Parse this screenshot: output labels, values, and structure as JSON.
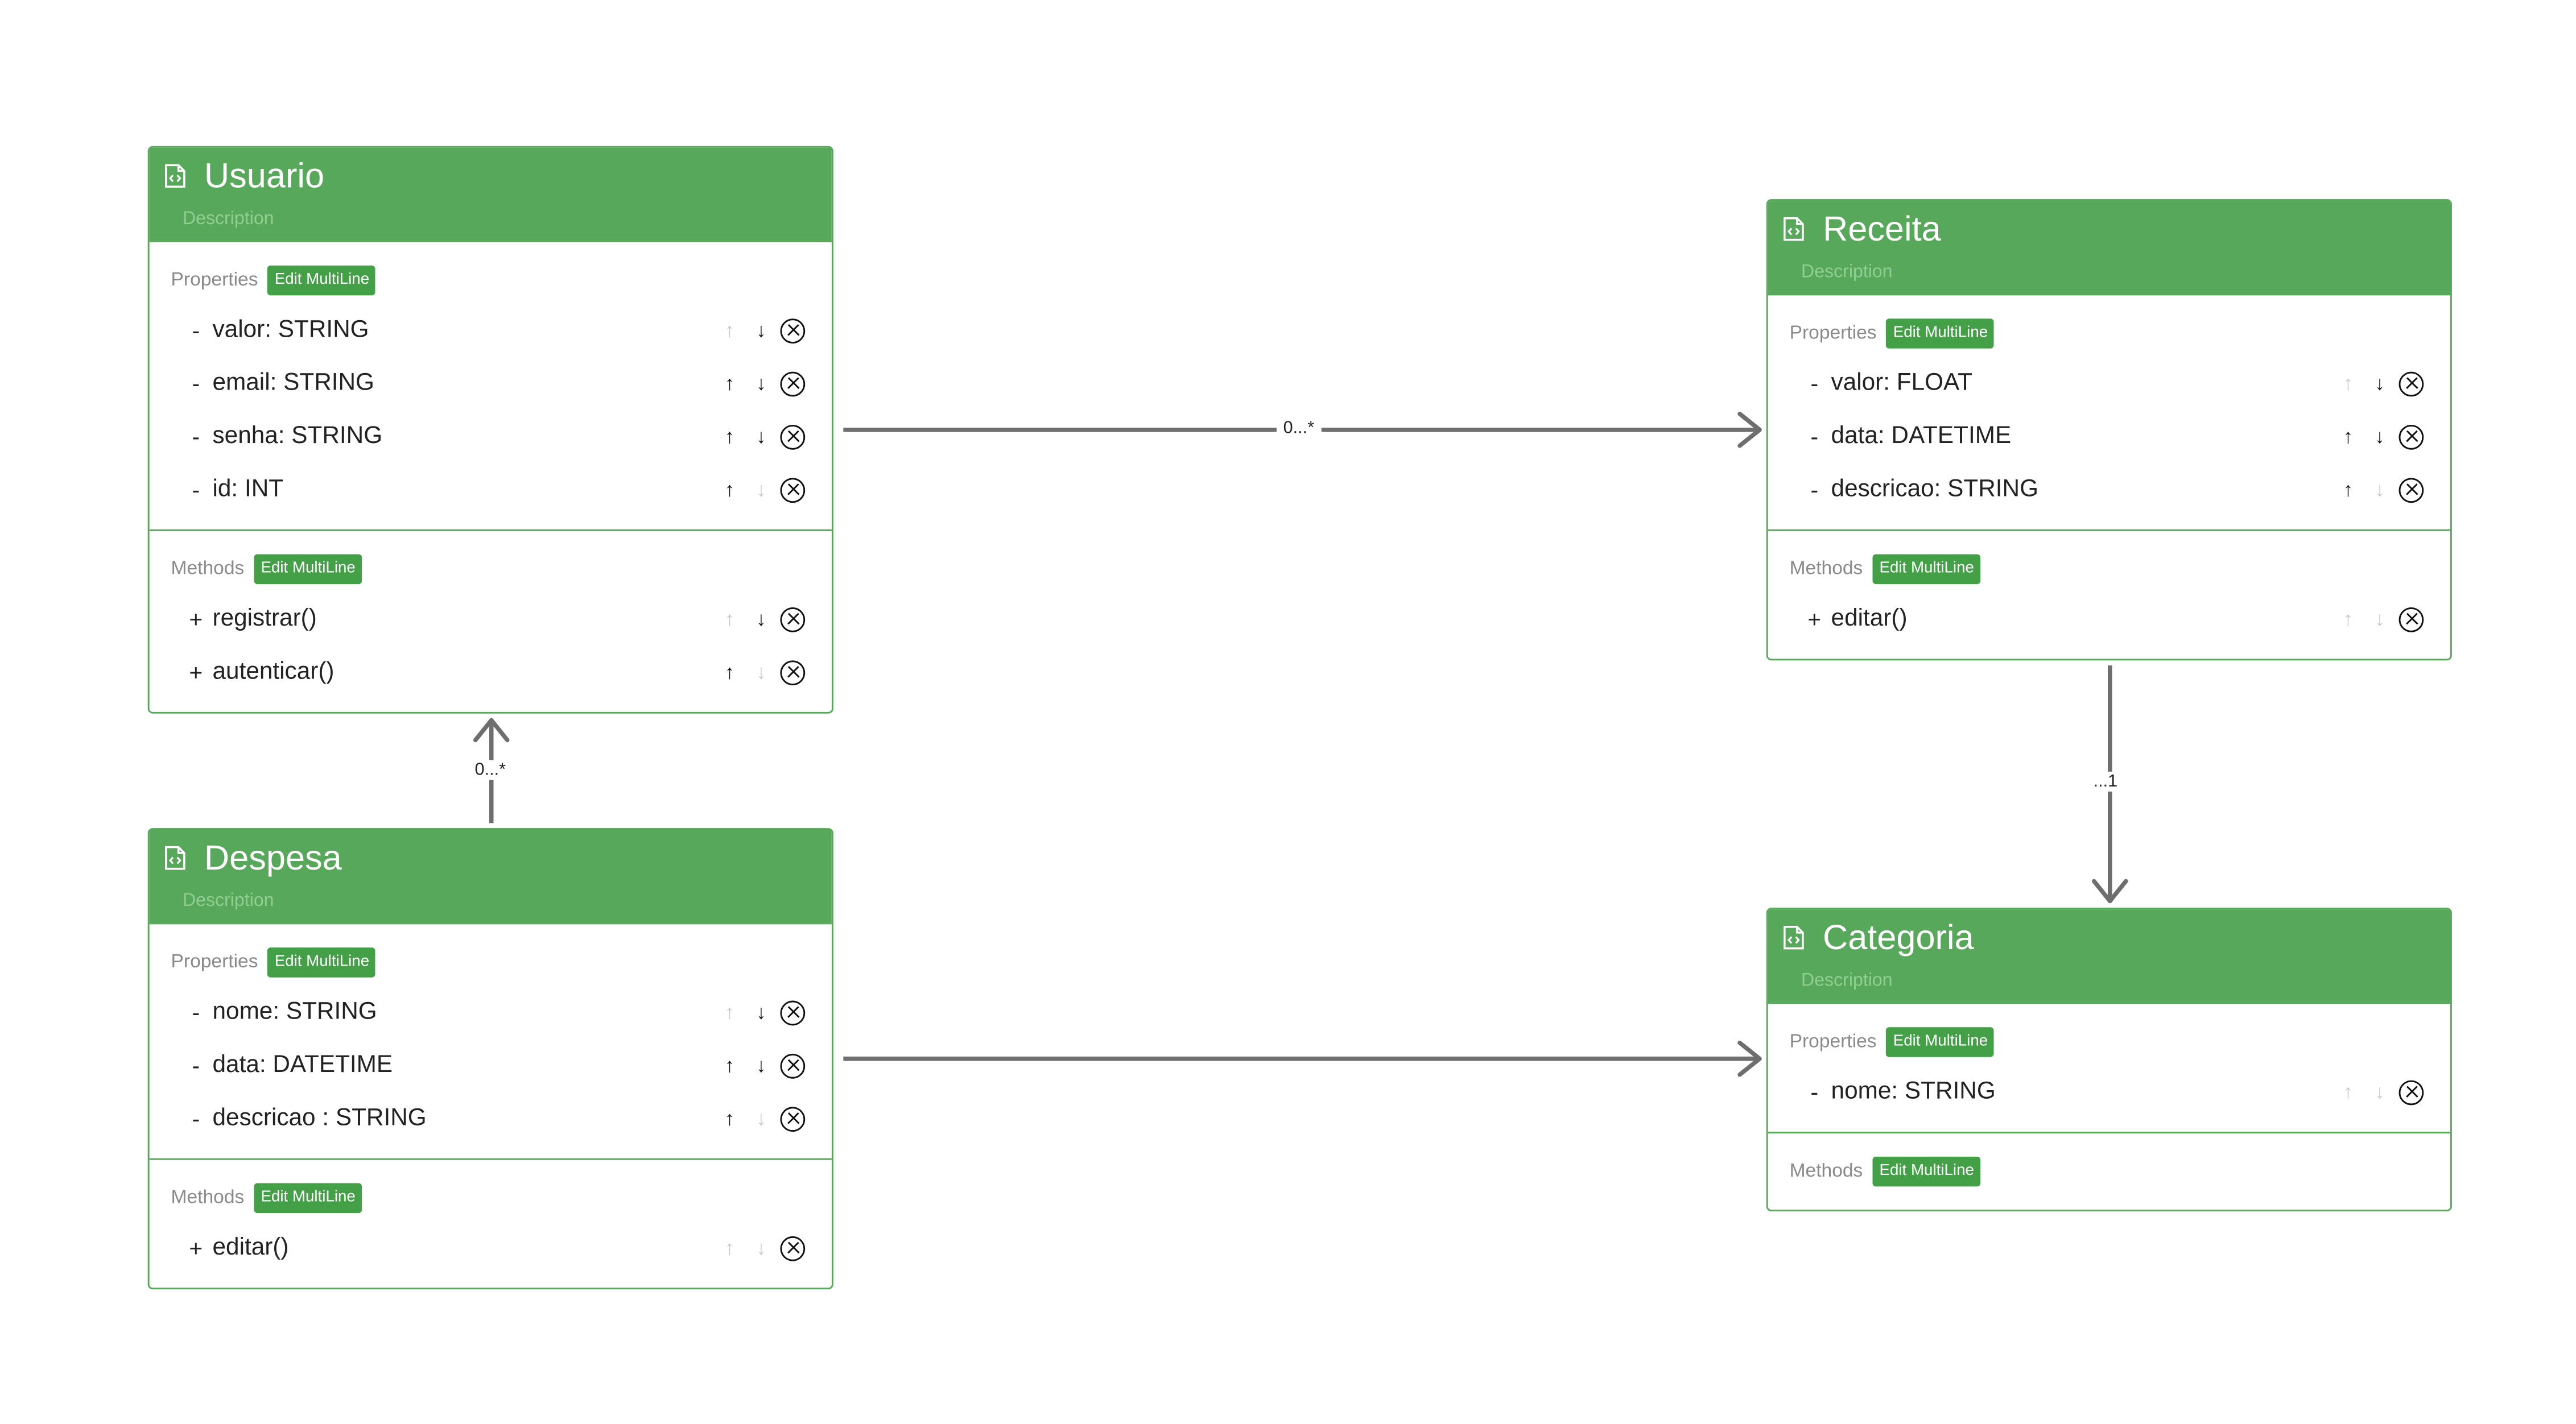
{
  "colors": {
    "header": "#57a85a",
    "border": "#57a85a",
    "button": "#43a047",
    "edge": "#6e6e6e"
  },
  "icons": {
    "class_icon": "file-code-icon",
    "up": "arrow-up-icon",
    "down": "arrow-down-icon",
    "delete": "circle-x-icon"
  },
  "classes": [
    {
      "id": "usuario",
      "title": "Usuario",
      "description": "Description",
      "properties_label": "Properties",
      "methods_label": "Methods",
      "edit_label": "Edit MultiLine",
      "properties": [
        {
          "vis": "-",
          "text": "valor: STRING",
          "up": false,
          "down": true
        },
        {
          "vis": "-",
          "text": "email: STRING",
          "up": true,
          "down": true
        },
        {
          "vis": "-",
          "text": "senha: STRING",
          "up": true,
          "down": true
        },
        {
          "vis": "-",
          "text": "id: INT",
          "up": true,
          "down": false
        }
      ],
      "methods": [
        {
          "vis": "+",
          "text": "registrar()",
          "up": false,
          "down": true
        },
        {
          "vis": "+",
          "text": "autenticar()",
          "up": true,
          "down": false
        }
      ]
    },
    {
      "id": "receita",
      "title": "Receita",
      "description": "Description",
      "properties_label": "Properties",
      "methods_label": "Methods",
      "edit_label": "Edit MultiLine",
      "properties": [
        {
          "vis": "-",
          "text": "valor: FLOAT",
          "up": false,
          "down": true
        },
        {
          "vis": "-",
          "text": "data: DATETIME",
          "up": true,
          "down": true
        },
        {
          "vis": "-",
          "text": "descricao: STRING",
          "up": true,
          "down": false
        }
      ],
      "methods": [
        {
          "vis": "+",
          "text": "editar()",
          "up": false,
          "down": false
        }
      ]
    },
    {
      "id": "despesa",
      "title": "Despesa",
      "description": "Description",
      "properties_label": "Properties",
      "methods_label": "Methods",
      "edit_label": "Edit MultiLine",
      "properties": [
        {
          "vis": "-",
          "text": "nome: STRING",
          "up": false,
          "down": true
        },
        {
          "vis": "-",
          "text": "data: DATETIME",
          "up": true,
          "down": true
        },
        {
          "vis": "-",
          "text": "descricao : STRING",
          "up": true,
          "down": false
        }
      ],
      "methods": [
        {
          "vis": "+",
          "text": "editar()",
          "up": false,
          "down": false
        }
      ]
    },
    {
      "id": "categoria",
      "title": "Categoria",
      "description": "Description",
      "properties_label": "Properties",
      "methods_label": "Methods",
      "edit_label": "Edit MultiLine",
      "properties": [
        {
          "vis": "-",
          "text": "nome: STRING",
          "up": false,
          "down": false
        }
      ],
      "methods": []
    }
  ],
  "edges": [
    {
      "from": "usuario",
      "to": "receita",
      "label": "0...*"
    },
    {
      "from": "despesa",
      "to": "usuario",
      "label": "0...*"
    },
    {
      "from": "receita",
      "to": "categoria",
      "label": "...1"
    },
    {
      "from": "despesa",
      "to": "categoria",
      "label": ""
    }
  ]
}
